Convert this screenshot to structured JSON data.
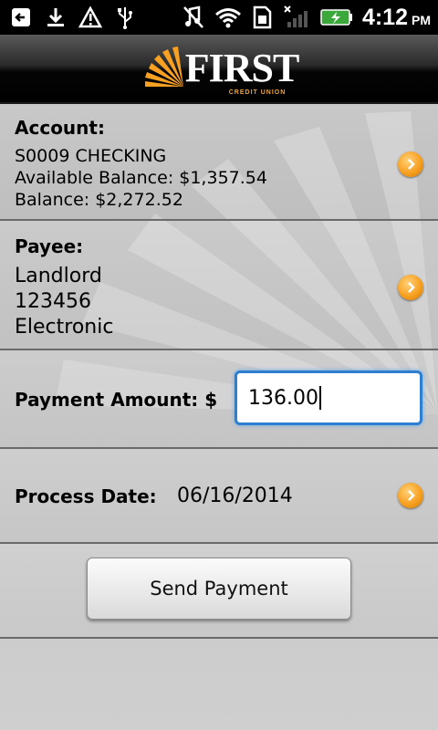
{
  "status_bar": {
    "time": "4:12",
    "ampm": "PM",
    "icons": [
      "back-arrow-icon",
      "download-icon",
      "warning-icon",
      "usb-icon",
      "muted-icon",
      "wifi-icon",
      "sim-card-icon",
      "no-signal-icon",
      "battery-charging-icon"
    ]
  },
  "header": {
    "logo_text": "FIRST",
    "logo_subtext": "CREDIT UNION",
    "brand_color": "#f7a021"
  },
  "account": {
    "label": "Account:",
    "name": "S0009 CHECKING",
    "available_balance": "Available Balance: $1,357.54",
    "balance": "Balance: $2,272.52"
  },
  "payee": {
    "label": "Payee:",
    "name": "Landlord",
    "number": "123456",
    "method": "Electronic"
  },
  "payment": {
    "label": "Payment Amount: $",
    "amount": "136.00",
    "input_border_color": "#2f7fd0"
  },
  "process_date": {
    "label": "Process Date:",
    "date": "06/16/2014"
  },
  "send_button": {
    "label": "Send Payment"
  }
}
